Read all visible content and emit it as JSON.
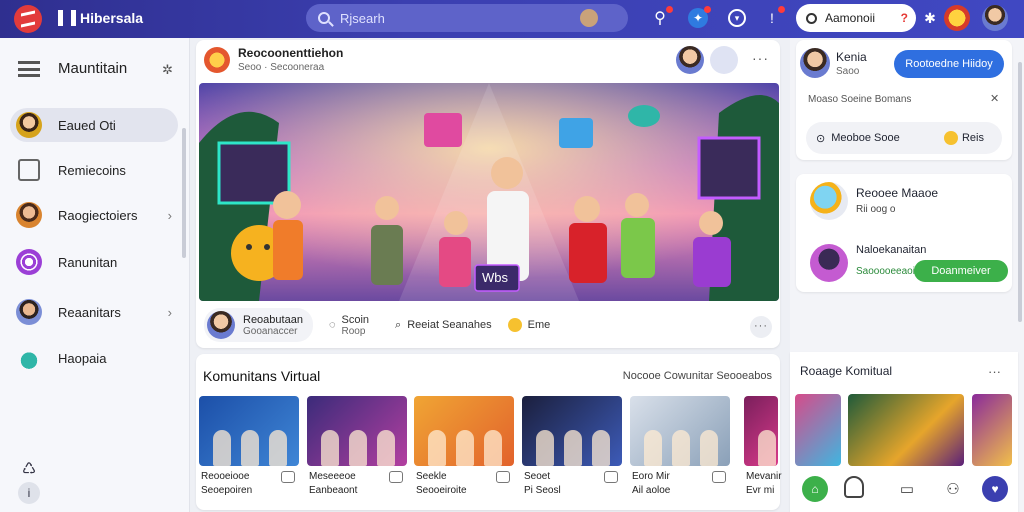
{
  "topbar": {
    "brand": "Hibersala",
    "search_placeholder": "Rjsearh",
    "right_search": "Aamonoii",
    "right_search_mark": "?"
  },
  "sidebar": {
    "title": "Mauntitain",
    "items": [
      {
        "label": "Eaued Oti",
        "active": true
      },
      {
        "label": "Remiecoins",
        "active": false
      },
      {
        "label": "Raogiectoiers",
        "active": false,
        "chevron": "›"
      },
      {
        "label": "Ranunitan",
        "active": false
      },
      {
        "label": "Reaanitars",
        "active": false,
        "chevron": "›"
      },
      {
        "label": "Haopaia",
        "active": false
      }
    ]
  },
  "post": {
    "author": "Reocoonenttiehon",
    "meta": "Seoo · Secooneraa",
    "hero_sign": "Wbs",
    "footer": {
      "user_name": "Reoabutaan",
      "user_sub": "Gooanaccer",
      "comments_count": "Scoin",
      "comments_sub": "Roop",
      "share_label": "Reeiat Seanahes",
      "reaction_label": "Eme"
    }
  },
  "communities": {
    "title": "Komunitans Virtual",
    "link": "Nocooe Cowunitar Seooeabos",
    "tiles": [
      {
        "title": "Reooeiooe",
        "sub": "Seoepoiren",
        "colors": [
          "#1c4fa8",
          "#3f86d6"
        ]
      },
      {
        "title": "Meseeeoe",
        "sub": "Eanbeaont",
        "colors": [
          "#3b2b7a",
          "#b33fa0"
        ]
      },
      {
        "title": "Seekle",
        "sub": "Seooeiroite",
        "colors": [
          "#f0a534",
          "#e2622c"
        ]
      },
      {
        "title": "Seoet",
        "sub": "Pi Seosl",
        "colors": [
          "#1b1f3d",
          "#3d5bb8"
        ]
      },
      {
        "title": "Eoro Mir",
        "sub": "Ail aoloe",
        "colors": [
          "#d9e0ea",
          "#8aa0b8"
        ]
      },
      {
        "title": "Mevanir",
        "sub": "Evr mi",
        "colors": [
          "#7a1f5c",
          "#d83a8a"
        ]
      }
    ]
  },
  "right": {
    "profile": {
      "name": "Kenia",
      "sub": "Saoo",
      "button": "Rootoedne Hiidoy"
    },
    "section_label": "Moaso Soeine Bomans",
    "row": {
      "label": "Meoboe Sooe",
      "tag": "Reis"
    },
    "friends": [
      {
        "name": "Reooee Maaoe",
        "sub": "Rii oog o"
      },
      {
        "name": "Naloekanaitan",
        "sub": "Saooooeeaoi",
        "button": "Doanmeiver"
      }
    ],
    "lower_title": "Roaage Komitual",
    "nav_icons": [
      "home-icon",
      "bell-icon",
      "chat-icon",
      "profile-icon",
      "heart-icon"
    ]
  }
}
